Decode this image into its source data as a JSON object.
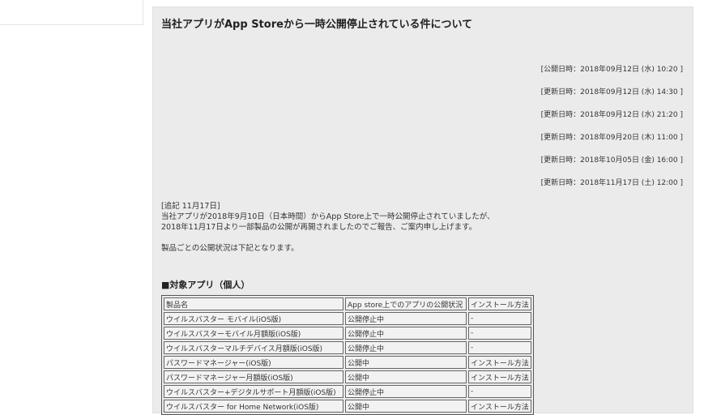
{
  "title": "当社アプリがApp Storeから一時公開停止されている件について",
  "dates": [
    "[公開日時：2018年09月12日 (水) 10:20 ]",
    "[更新日時：2018年09月12日 (水) 14:30 ]",
    "[更新日時：2018年09月12日 (水) 21:20 ]",
    "[更新日時：2018年09月20日 (木) 11:00 ]",
    "[更新日時：2018年10月05日 (金) 16:00 ]",
    "[更新日時：2018年11月17日 (土) 12:00 ]"
  ],
  "notice": {
    "addendum": "[追記 11月17日]",
    "line1": "当社アプリが2018年9月10日（日本時間）からApp Store上で一時公開停止されていましたが、",
    "line2": "2018年11月17日より一部製品の公開が再開されましたのでご報告、ご案内申し上げます。",
    "line3": "製品ごとの公開状況は下記となります。"
  },
  "section_title": "■対象アプリ（個人）",
  "table": {
    "headers": [
      "製品名",
      "App store上でのアプリの公開状況",
      "インストール方法"
    ],
    "rows": [
      [
        "ウイルスバスター モバイル(iOS版)",
        "公開停止中",
        "-"
      ],
      [
        "ウイルスバスターモバイル月額版(iOS版)",
        "公開停止中",
        "-"
      ],
      [
        "ウイルスバスターマルチデバイス月額版(iOS版)",
        "公開停止中",
        "-"
      ],
      [
        "パスワードマネージャー(iOS版)",
        "公開中",
        "インストール方法"
      ],
      [
        "パスワードマネージャー月額版(iOS版)",
        "公開中",
        "インストール方法"
      ],
      [
        "ウイルスバスター+デジタルサポート月額版(iOS版)",
        "公開停止中",
        "-"
      ],
      [
        "ウイルスバスター for Home Network(iOS版)",
        "公開中",
        "インストール方法"
      ]
    ]
  },
  "colors": {
    "link": "#e0302a",
    "panel": "#ebebeb"
  }
}
